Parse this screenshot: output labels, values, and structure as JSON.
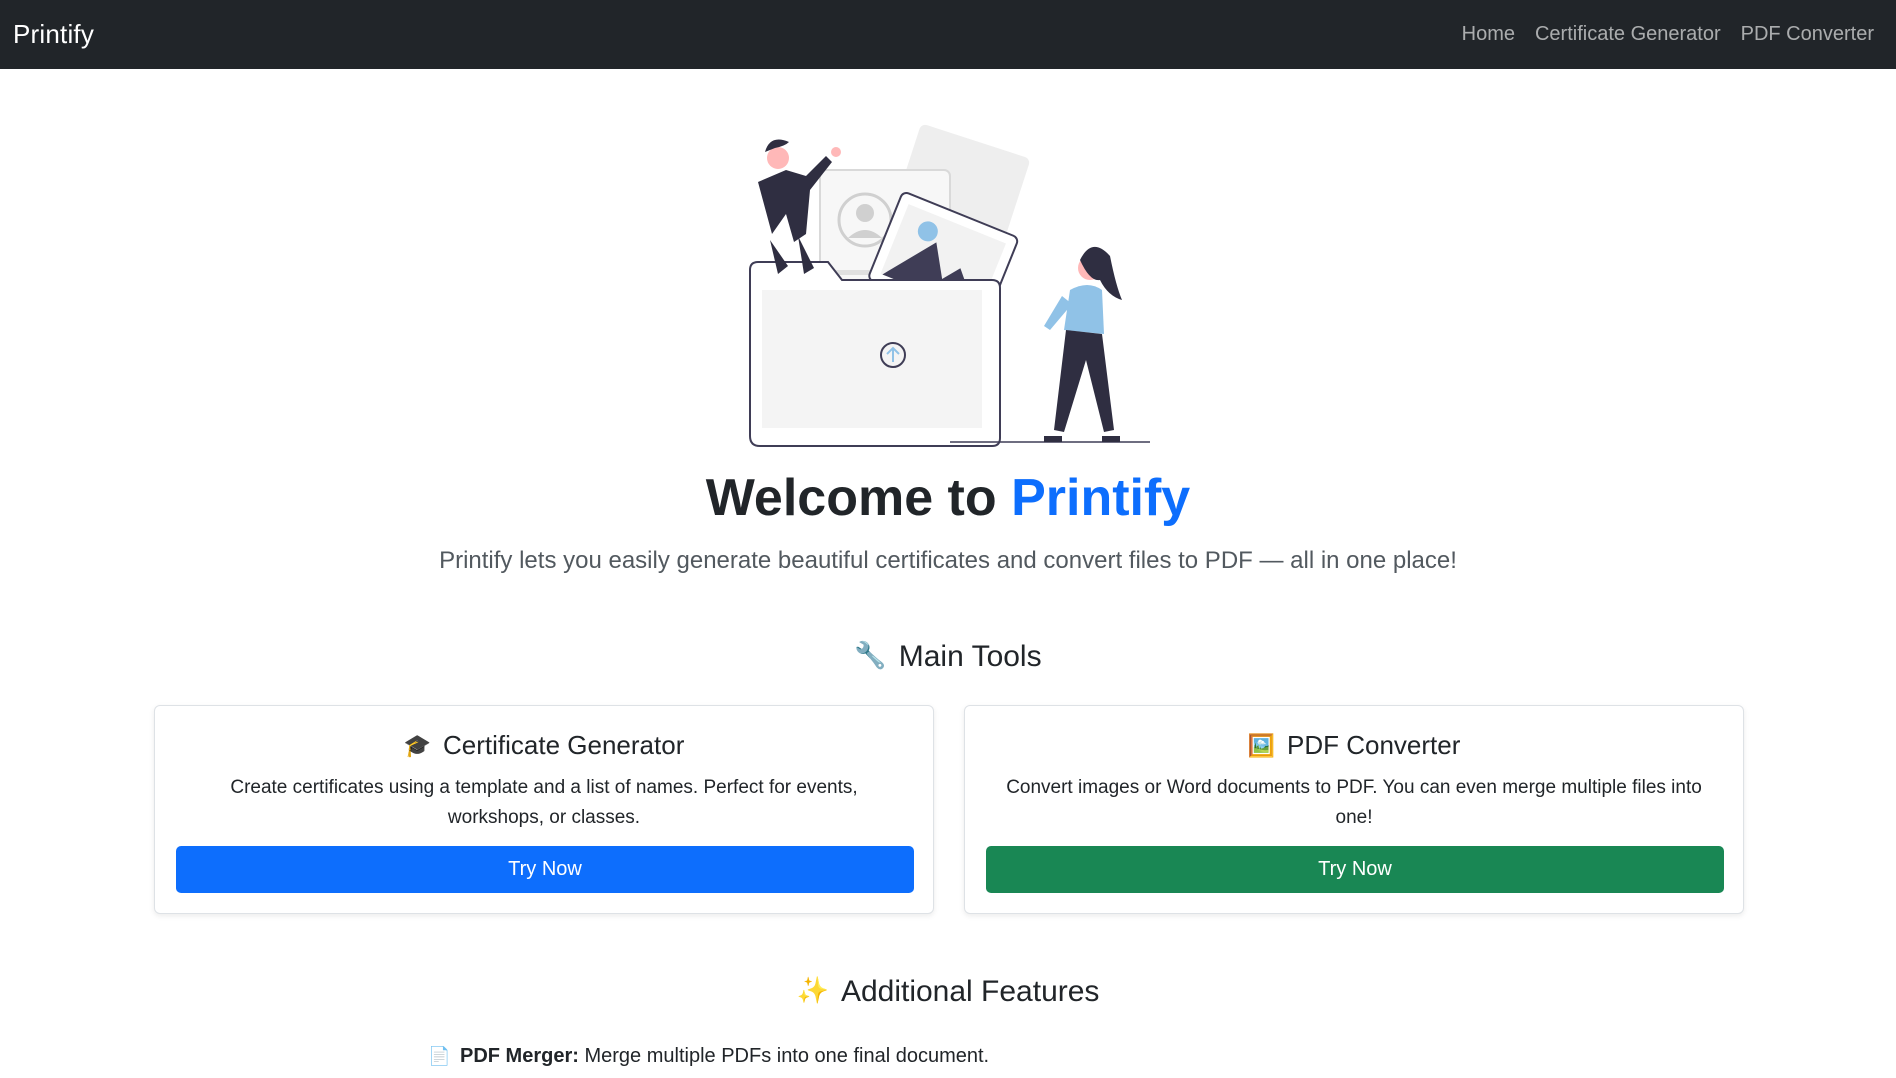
{
  "navbar": {
    "brand": "Printify",
    "links": [
      "Home",
      "Certificate Generator",
      "PDF Converter"
    ]
  },
  "hero": {
    "illustration_icon": "file-upload-illustration",
    "title_prefix": "Welcome to",
    "title_accent": "Printify",
    "subtitle": "Printify lets you easily generate beautiful certificates and convert files to PDF — all in one place!"
  },
  "main_tools": {
    "emoji": "🔧",
    "heading": "Main Tools",
    "cards": [
      {
        "emoji": "🎓",
        "title": "Certificate Generator",
        "text": "Create certificates using a template and a list of names. Perfect for events, workshops, or classes.",
        "button": "Try Now",
        "button_color": "#0d6efd"
      },
      {
        "emoji": "🖼️",
        "title": "PDF Converter",
        "text": "Convert images or Word documents to PDF. You can even merge multiple files into one!",
        "button": "Try Now",
        "button_color": "#198754"
      }
    ]
  },
  "additional_features": {
    "emoji": "✨",
    "heading": "Additional Features",
    "items": [
      {
        "emoji": "📄",
        "name": "PDF Merger:",
        "text": "Merge multiple PDFs into one final document."
      }
    ]
  },
  "colors": {
    "navbar_bg": "#212529",
    "accent": "#0d6efd",
    "success": "#198754"
  }
}
